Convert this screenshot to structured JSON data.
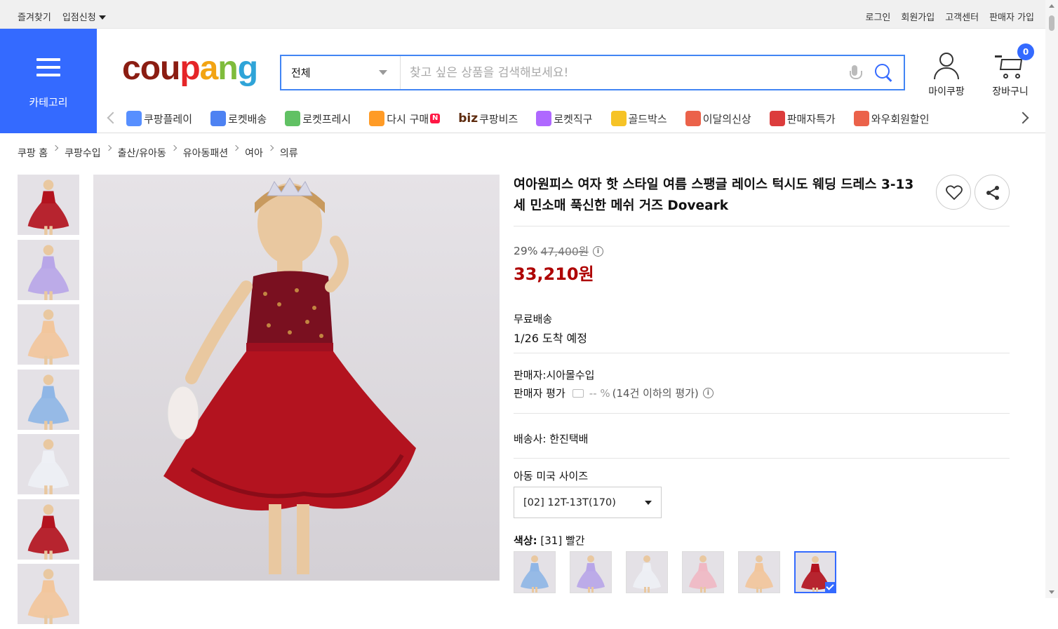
{
  "topbar": {
    "favorites": "즐겨찾기",
    "store_apply": "입점신청",
    "login": "로그인",
    "signup": "회원가입",
    "customer_center": "고객센터",
    "seller_signup": "판매자 가입"
  },
  "header": {
    "category_label": "카테고리",
    "logo": [
      "cou",
      "p",
      "a",
      "n",
      "g"
    ],
    "search_scope": "전체",
    "search_placeholder": "찾고 싶은 상품을 검색해보세요!",
    "my_coupang": "마이쿠팡",
    "cart_label": "장바구니",
    "cart_count": "0"
  },
  "nav": {
    "items": [
      {
        "label": "쿠팡플레이",
        "icon": "play-icon",
        "color": "#3a7bff"
      },
      {
        "label": "로켓배송",
        "icon": "rocket-icon",
        "color": "#2f6cf0"
      },
      {
        "label": "로켓프레시",
        "icon": "rocket-fresh-icon",
        "color": "#45b649"
      },
      {
        "label": "다시 구매",
        "icon": "rebuy-icon",
        "color": "#ff8a00"
      },
      {
        "label": "쿠팡비즈",
        "icon": "biz-icon",
        "color": "#5e2c0f"
      },
      {
        "label": "로켓직구",
        "icon": "rocket-global-icon",
        "color": "#a14dff"
      },
      {
        "label": "골드박스",
        "icon": "goldbox-icon",
        "color": "#f5b800"
      },
      {
        "label": "이달의신상",
        "icon": "new-icon",
        "color": "#e8462a"
      },
      {
        "label": "판매자특가",
        "icon": "percent-icon",
        "color": "#d61a1a"
      },
      {
        "label": "와우회원할인",
        "icon": "wow-icon",
        "color": "#e8462a"
      }
    ],
    "biz_prefix": "biz",
    "rebuy_badge": "N"
  },
  "breadcrumb": [
    "쿠팡 홈",
    "쿠팡수입",
    "출산/유아동",
    "유아동패션",
    "여아",
    "의류"
  ],
  "product": {
    "title": "여아원피스 여자 핫 스타일 여름 스팽글 레이스 턱시도 웨딩 드레스 3-13 세 민소매 푹신한 메쉬 거즈 Doveark",
    "discount_rate": "29%",
    "original_price": "47,400원",
    "price": "33,210원",
    "shipping_label": "무료배송",
    "arrival": "1/26 도착 예정",
    "seller": "판매자:시아몰수입",
    "seller_rating_label": "판매자 평가",
    "seller_rating_value": "-- %",
    "seller_rating_count": "(14건 이하의 평가)",
    "carrier": "배송사:  한진택배",
    "size_label": "아동 미국 사이즈",
    "size_selected": "[02] 12T-13T(170)",
    "color_label_prefix": "색상:",
    "color_selected": "[31] 빨간",
    "info_glyph": "i"
  },
  "colors": {
    "accent": "#346aff",
    "price_red": "#ae0000",
    "dress_variants": [
      "#8fb6e6",
      "#b8a6e8",
      "#eef0f5",
      "#f0b8c4",
      "#f2c69c",
      "#b3131f"
    ]
  },
  "thumbnails": [
    "#b3131f",
    "#b8a6e8",
    "#f2c69c",
    "#8fb6e6",
    "#eef0f5",
    "#b3131f",
    "#f2c69c"
  ]
}
